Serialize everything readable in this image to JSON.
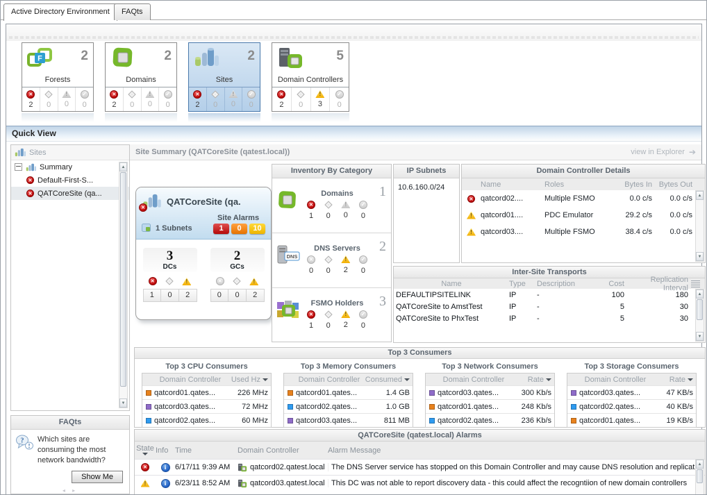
{
  "tabs": [
    {
      "label": "Active Directory Environment"
    },
    {
      "label": "FAQts"
    }
  ],
  "tiles": [
    {
      "name": "Forests",
      "count": "2",
      "statuses": [
        {
          "type": "error",
          "count": "2"
        },
        {
          "type": "unknown",
          "count": "0"
        },
        {
          "type": "warning",
          "count": "0"
        },
        {
          "type": "normal",
          "count": "0"
        }
      ]
    },
    {
      "name": "Domains",
      "count": "2",
      "statuses": [
        {
          "type": "error",
          "count": "2"
        },
        {
          "type": "unknown",
          "count": "0"
        },
        {
          "type": "warning",
          "count": "0"
        },
        {
          "type": "normal",
          "count": "0"
        }
      ]
    },
    {
      "name": "Sites",
      "count": "2",
      "selected": true,
      "statuses": [
        {
          "type": "error",
          "count": "2"
        },
        {
          "type": "unknown",
          "count": "0"
        },
        {
          "type": "warning",
          "count": "0"
        },
        {
          "type": "normal",
          "count": "0"
        }
      ]
    },
    {
      "name": "Domain Controllers",
      "count": "5",
      "statuses": [
        {
          "type": "error",
          "count": "2"
        },
        {
          "type": "unknown",
          "count": "0"
        },
        {
          "type": "warning",
          "count": "3"
        },
        {
          "type": "normal",
          "count": "0"
        }
      ]
    }
  ],
  "quick_view": {
    "title": "Quick View",
    "sidebar": {
      "header": "Sites",
      "items": [
        {
          "label": "Summary"
        },
        {
          "label": "Default-First-S..."
        },
        {
          "label": "QATCoreSite (qa...",
          "selected": true
        }
      ]
    },
    "faqts": {
      "header": "FAQts",
      "question": "Which sites are consuming the most network bandwidth?",
      "show_me": "Show Me"
    },
    "summary": {
      "title": "Site Summary (QATCoreSite (qatest.local))",
      "action": "view in Explorer"
    },
    "site_card": {
      "title": "QATCoreSite (qa.",
      "subnets": "1 Subnets",
      "alarms_label": "Site Alarms",
      "alarm_counts": {
        "fatal": "1",
        "critical": "0",
        "warning": "10"
      },
      "dcs": {
        "count": "3",
        "label": "DCs",
        "counts": [
          "1",
          "0",
          "2"
        ]
      },
      "gcs": {
        "count": "2",
        "label": "GCs",
        "counts": [
          "0",
          "0",
          "2"
        ]
      }
    },
    "inventory": {
      "header": "Inventory By Category",
      "items": [
        {
          "name": "Domains",
          "count": "1",
          "statuses": [
            {
              "type": "error",
              "count": "1"
            },
            {
              "type": "unknown",
              "count": "0"
            },
            {
              "type": "warning",
              "count": "0"
            },
            {
              "type": "normal",
              "count": "0"
            }
          ]
        },
        {
          "name": "DNS Servers",
          "count": "2",
          "statuses": [
            {
              "type": "error",
              "count": "0"
            },
            {
              "type": "unknown",
              "count": "0"
            },
            {
              "type": "warning",
              "count": "2"
            },
            {
              "type": "normal",
              "count": "0"
            }
          ]
        },
        {
          "name": "FSMO Holders",
          "count": "3",
          "statuses": [
            {
              "type": "error",
              "count": "1"
            },
            {
              "type": "unknown",
              "count": "0"
            },
            {
              "type": "warning",
              "count": "2"
            },
            {
              "type": "normal",
              "count": "0"
            }
          ]
        }
      ]
    },
    "ip_subnets": {
      "header": "IP Subnets",
      "values": [
        "10.6.160.0/24"
      ]
    },
    "dc_details": {
      "header": "Domain Controller Details",
      "columns": [
        "Name",
        "Roles",
        "Bytes In",
        "Bytes Out"
      ],
      "rows": [
        {
          "state": "error",
          "name": "qatcord02....",
          "roles": "Multiple FSMO",
          "bytes_in": "0.0 c/s",
          "bytes_out": "0.0 c/s"
        },
        {
          "state": "warning",
          "name": "qatcord01....",
          "roles": "PDC Emulator",
          "bytes_in": "29.2 c/s",
          "bytes_out": "0.0 c/s"
        },
        {
          "state": "warning",
          "name": "qatcord03....",
          "roles": "Multiple FSMO",
          "bytes_in": "38.4 c/s",
          "bytes_out": "0.0 c/s"
        }
      ]
    },
    "transports": {
      "header": "Inter-Site Transports",
      "columns": [
        "Name",
        "Type",
        "Description",
        "Cost",
        "Replication Interval"
      ],
      "rows": [
        {
          "name": "DEFAULTIPSITELINK",
          "type": "IP",
          "description": "-",
          "cost": "100",
          "interval": "180"
        },
        {
          "name": "QATCoreSite to AmstTest",
          "type": "IP",
          "description": "-",
          "cost": "5",
          "interval": "30"
        },
        {
          "name": "QATCoreSite to PhxTest",
          "type": "IP",
          "description": "-",
          "cost": "5",
          "interval": "30"
        }
      ]
    },
    "top_consumers": {
      "header": "Top 3 Consumers",
      "name_col": "Domain Controller",
      "tables": [
        {
          "title": "Top 3 CPU Consumers",
          "value_col": "Used Hz",
          "rows": [
            {
              "swatch": "orange",
              "name": "qatcord01.qates...",
              "value": "226 MHz"
            },
            {
              "swatch": "purple",
              "name": "qatcord03.qates...",
              "value": "72 MHz"
            },
            {
              "swatch": "blue",
              "name": "qatcord02.qates...",
              "value": "60 MHz"
            }
          ]
        },
        {
          "title": "Top 3 Memory Consumers",
          "value_col": "Consumed",
          "rows": [
            {
              "swatch": "orange",
              "name": "qatcord01.qates...",
              "value": "1.4 GB"
            },
            {
              "swatch": "blue",
              "name": "qatcord02.qates...",
              "value": "1.0 GB"
            },
            {
              "swatch": "purple",
              "name": "qatcord03.qates...",
              "value": "811 MB"
            }
          ]
        },
        {
          "title": "Top 3 Network Consumers",
          "value_col": "Rate",
          "rows": [
            {
              "swatch": "purple",
              "name": "qatcord03.qates...",
              "value": "300 Kb/s"
            },
            {
              "swatch": "orange",
              "name": "qatcord01.qates...",
              "value": "248 Kb/s"
            },
            {
              "swatch": "blue",
              "name": "qatcord02.qates...",
              "value": "236 Kb/s"
            }
          ]
        },
        {
          "title": "Top 3 Storage Consumers",
          "value_col": "Rate",
          "rows": [
            {
              "swatch": "purple",
              "name": "qatcord03.qates...",
              "value": "47 KB/s"
            },
            {
              "swatch": "blue",
              "name": "qatcord02.qates...",
              "value": "40 KB/s"
            },
            {
              "swatch": "orange",
              "name": "qatcord01.qates...",
              "value": "19 KB/s"
            }
          ]
        }
      ]
    },
    "alarms": {
      "header": "QATCoreSite (qatest.local) Alarms",
      "columns": {
        "state": "State",
        "info": "Info",
        "time": "Time",
        "dc": "Domain Controller",
        "message": "Alarm Message"
      },
      "rows": [
        {
          "severity": "error",
          "time": "6/17/11 9:39 AM",
          "dc": "qatcord02.qatest.local",
          "message": "The DNS Server service has stopped on this Domain Controller and may cause DNS resolution and replicatio"
        },
        {
          "severity": "warning",
          "time": "6/23/11 8:52 AM",
          "dc": "qatcord03.qatest.local",
          "message": "This DC was not able to report discovery data - this could affect the recogntiion of new domain controllers"
        }
      ]
    }
  },
  "colors": {
    "selected_tile_border": "#4979ab",
    "error_red": "#bb0606",
    "warning_yellow": "#f2ae00",
    "badge_fatal": "#b40a0a",
    "badge_critical": "#e67300",
    "badge_warning": "#edb500",
    "swatch_orange": "#e8821e",
    "swatch_purple": "#8f6cc9",
    "swatch_blue": "#2f9bf0",
    "info_blue": "#1d5dc2"
  }
}
